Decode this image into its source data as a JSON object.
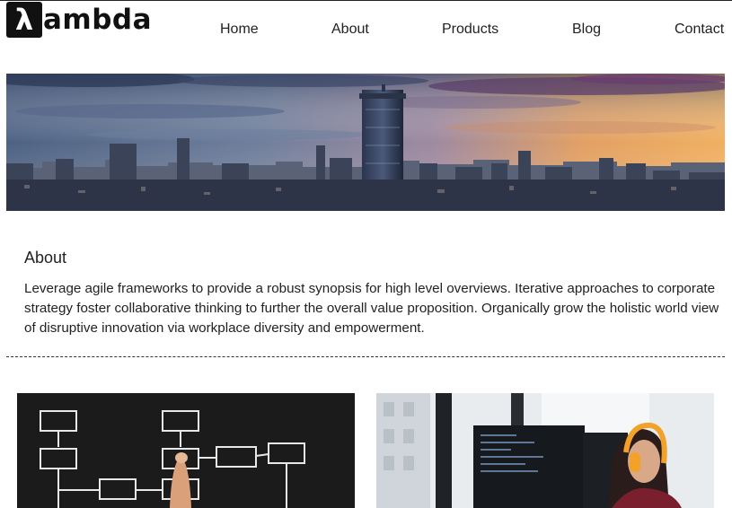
{
  "brand": {
    "logo_glyph": "λ",
    "logo_text": "ambda"
  },
  "nav": {
    "items": [
      {
        "label": "Home"
      },
      {
        "label": "About"
      },
      {
        "label": "Products"
      },
      {
        "label": "Blog"
      },
      {
        "label": "Contact"
      }
    ]
  },
  "hero": {
    "image": "city-skyline-sunset"
  },
  "about": {
    "heading": "About",
    "body": "Leverage agile frameworks to provide a robust synopsis for high level overviews. Iterative approaches to corporate strategy foster collaborative thinking to further the overall value proposition. Organically grow the holistic world view of disruptive innovation via workplace diversity and empowerment."
  },
  "cards": [
    {
      "image": "flowchart-chalkboard"
    },
    {
      "image": "developer-at-monitors"
    }
  ]
}
